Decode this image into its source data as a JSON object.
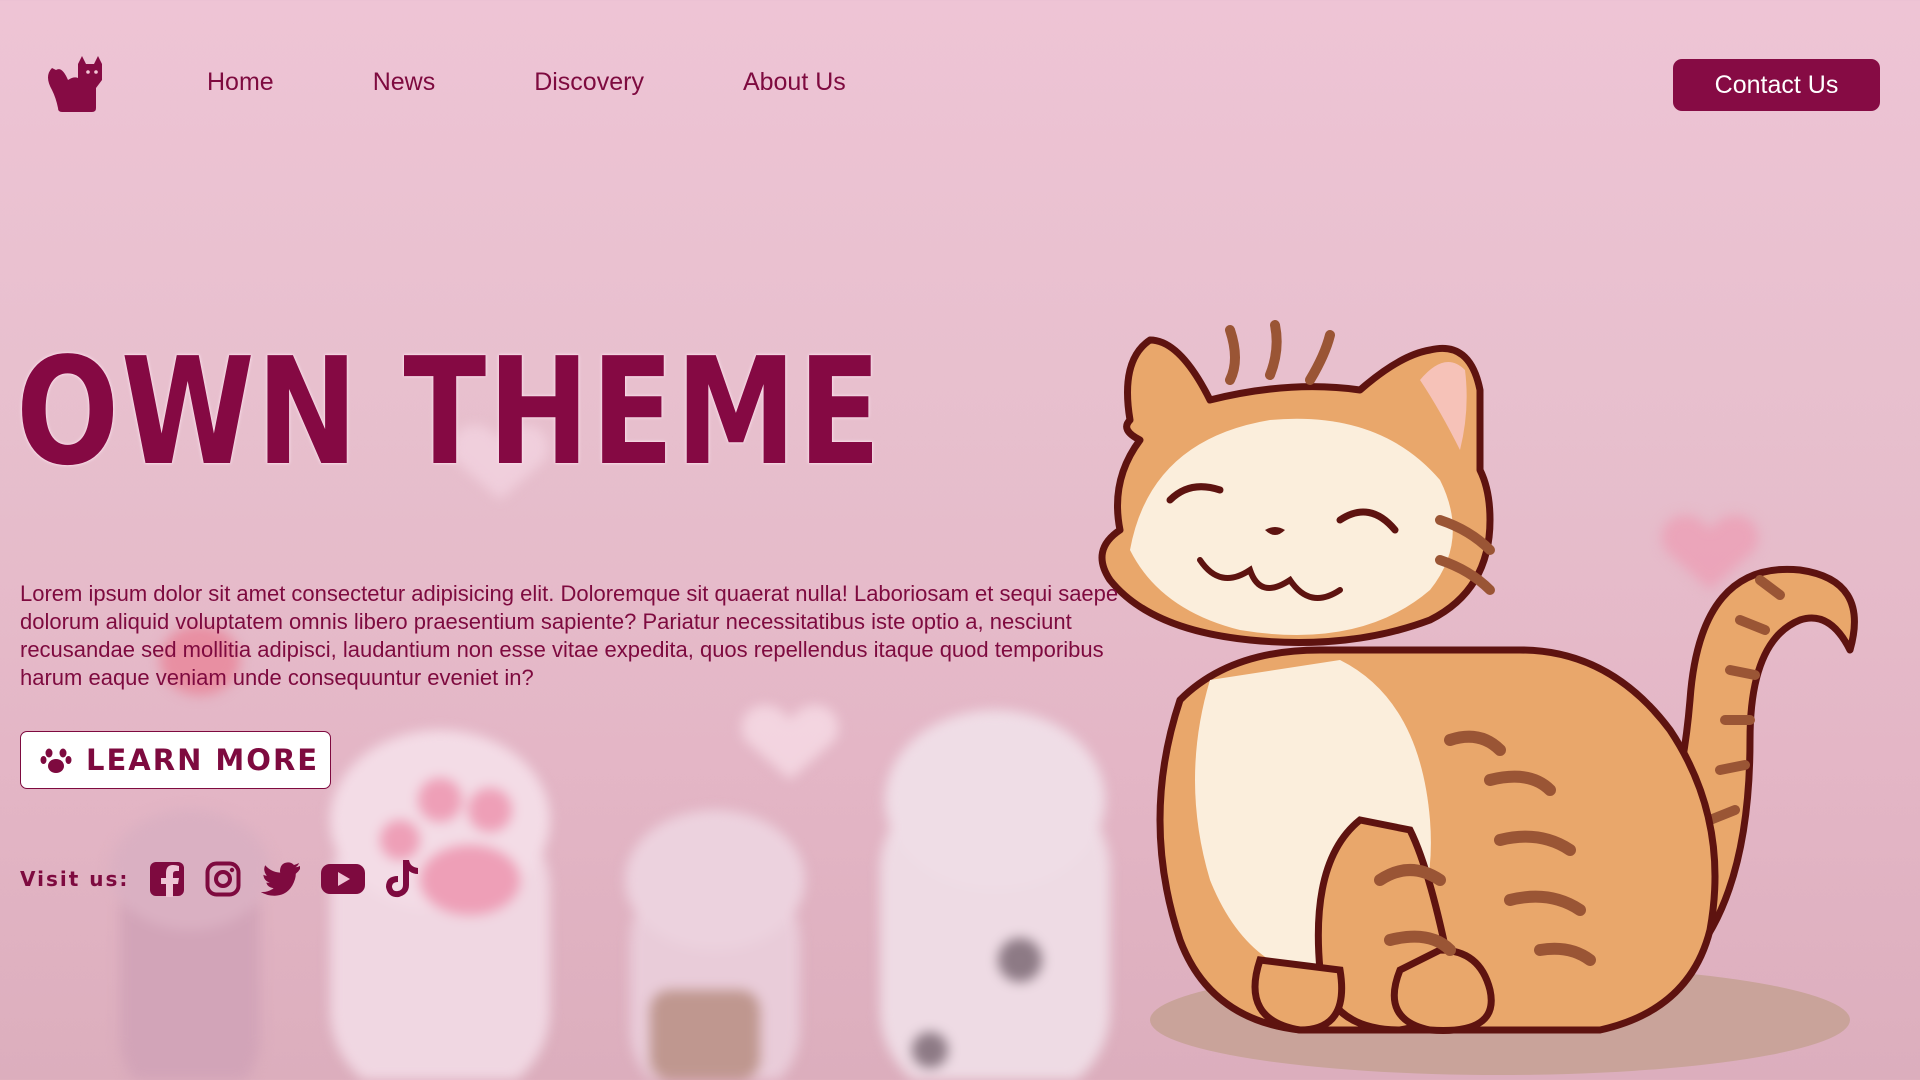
{
  "header": {
    "logo_icon": "cat-silhouette-icon",
    "nav": [
      {
        "label": "Home"
      },
      {
        "label": "News"
      },
      {
        "label": "Discovery"
      },
      {
        "label": "About Us"
      }
    ],
    "contact_label": "Contact Us"
  },
  "hero": {
    "title": "OWN THEME",
    "description": "Lorem ipsum dolor sit amet consectetur adipisicing elit. Doloremque sit quaerat nulla! Laboriosam et sequi saepe dolorum aliquid voluptatem omnis libero praesentium sapiente? Pariatur necessitatibus iste optio a, nesciunt recusandae sed mollitia adipisci, laudantium non esse vitae expedita, quos repellendus itaque quod temporibus harum eaque veniam unde consequuntur eveniet in?",
    "cta_label": "LEARN MORE",
    "cta_icon": "paw-icon"
  },
  "social": {
    "label": "Visit us:",
    "icons": [
      "facebook-icon",
      "instagram-icon",
      "twitter-icon",
      "youtube-icon",
      "tiktok-icon"
    ]
  },
  "colors": {
    "accent": "#860b44",
    "text": "#7e0a3f",
    "background": "#eec4d5",
    "button_bg": "#ffffff"
  }
}
